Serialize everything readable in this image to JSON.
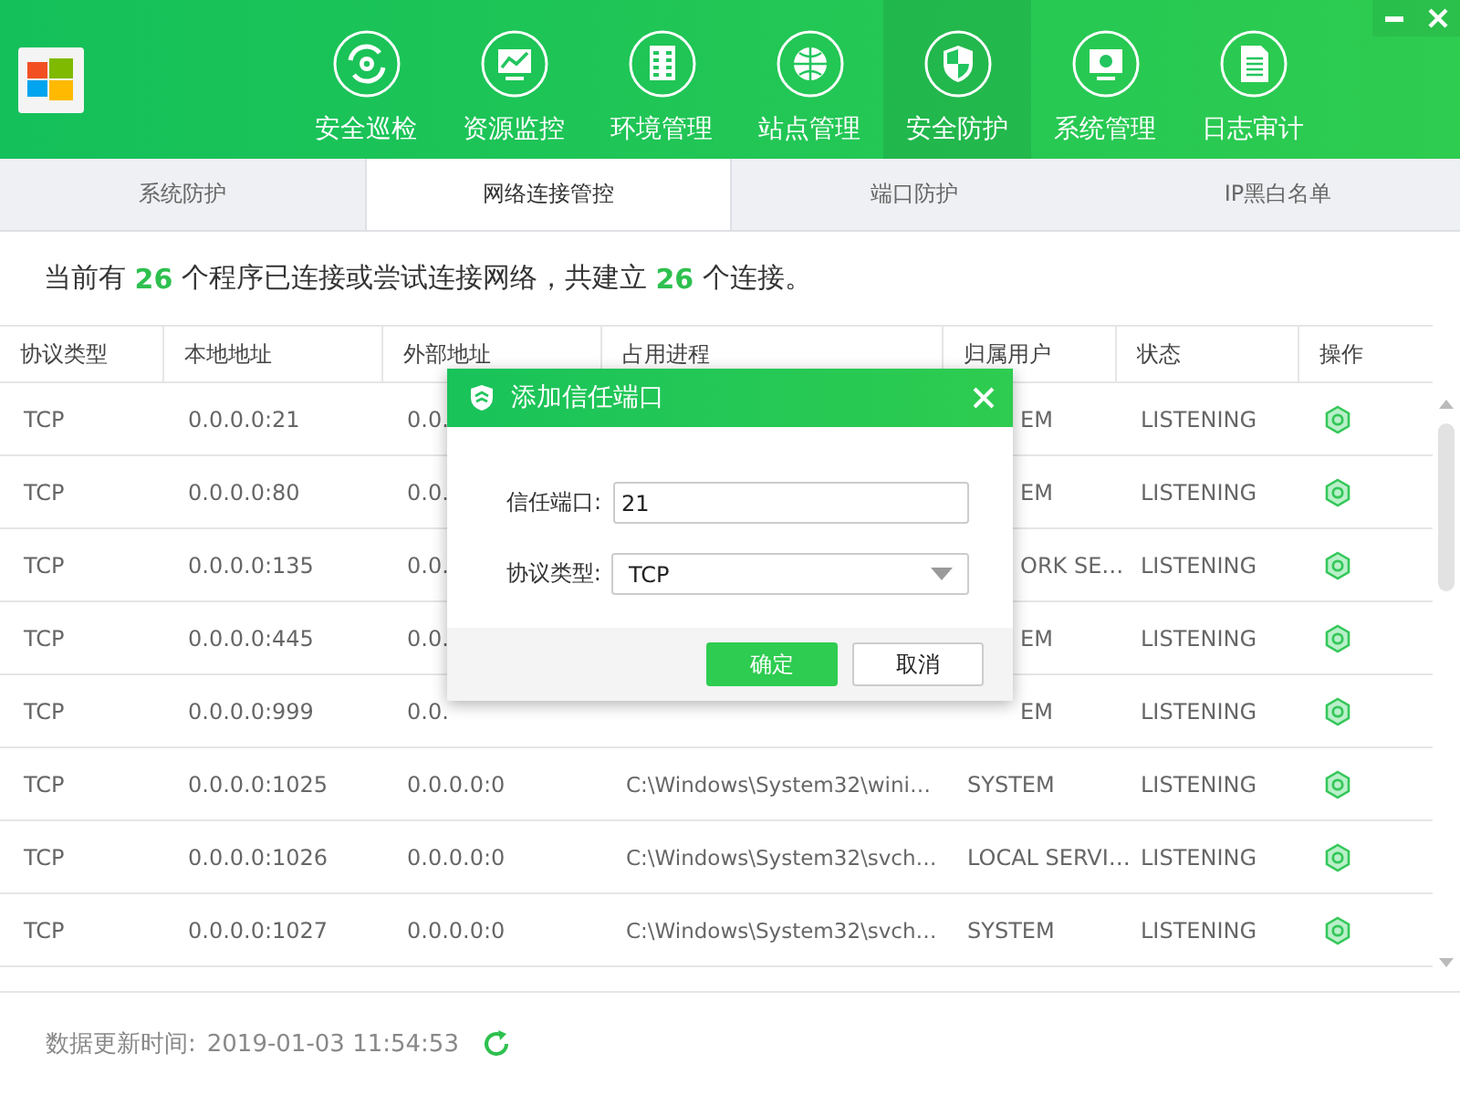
{
  "nav": [
    {
      "label": "安全巡检",
      "selected": false
    },
    {
      "label": "资源监控",
      "selected": false
    },
    {
      "label": "环境管理",
      "selected": false
    },
    {
      "label": "站点管理",
      "selected": false
    },
    {
      "label": "安全防护",
      "selected": true
    },
    {
      "label": "系统管理",
      "selected": false
    },
    {
      "label": "日志审计",
      "selected": false
    }
  ],
  "tabs": [
    {
      "label": "系统防护",
      "selected": false
    },
    {
      "label": "网络连接管控",
      "selected": true
    },
    {
      "label": "端口防护",
      "selected": false
    },
    {
      "label": "IP黑白名单",
      "selected": false
    }
  ],
  "summary": "当前有 **26** 个程序已连接或尝试连接网络，共建立 **26** 个连接。",
  "table": {
    "columns": [
      "协议类型",
      "本地地址",
      "外部地址",
      "占用进程",
      "归属用户",
      "状态",
      "操作"
    ],
    "rows": [
      {
        "under_dialog": true,
        "protocol": "TCP",
        "local": "0.0.0.0:21",
        "external": "0.0.",
        "user": "EM",
        "status": "LISTENING"
      },
      {
        "under_dialog": true,
        "protocol": "TCP",
        "local": "0.0.0.0:80",
        "external": "0.0.",
        "user": "EM",
        "status": "LISTENING"
      },
      {
        "under_dialog": true,
        "protocol": "TCP",
        "local": "0.0.0.0:135",
        "external": "0.0.",
        "user": "ORK SE…",
        "status": "LISTENING"
      },
      {
        "under_dialog": true,
        "protocol": "TCP",
        "local": "0.0.0.0:445",
        "external": "0.0.",
        "user": "EM",
        "status": "LISTENING"
      },
      {
        "under_dialog": true,
        "protocol": "TCP",
        "local": "0.0.0.0:999",
        "external": "0.0.",
        "user": "EM",
        "status": "LISTENING"
      },
      {
        "under_dialog": false,
        "protocol": "TCP",
        "local": "0.0.0.0:1025",
        "external": "0.0.0.0:0",
        "process": "C:\\Windows\\System32\\wini…",
        "user": "SYSTEM",
        "status": "LISTENING"
      },
      {
        "under_dialog": false,
        "protocol": "TCP",
        "local": "0.0.0.0:1026",
        "external": "0.0.0.0:0",
        "process": "C:\\Windows\\System32\\svch…",
        "user": "LOCAL SERVI…",
        "status": "LISTENING"
      },
      {
        "under_dialog": false,
        "protocol": "TCP",
        "local": "0.0.0.0:1027",
        "external": "0.0.0.0:0",
        "process": "C:\\Windows\\System32\\svch…",
        "user": "SYSTEM",
        "status": "LISTENING"
      }
    ]
  },
  "footer": {
    "label": "数据更新时间:",
    "time": "2019-01-03 11:54:53"
  },
  "dialog": {
    "title": "添加信任端口",
    "fields": [
      {
        "kind": "text",
        "label": "信任端口:",
        "value": "21"
      },
      {
        "kind": "select",
        "label": "协议类型:",
        "value": "TCP"
      }
    ],
    "buttons": [
      {
        "label": "确定",
        "primary": true
      },
      {
        "label": "取消",
        "primary": false
      }
    ]
  }
}
